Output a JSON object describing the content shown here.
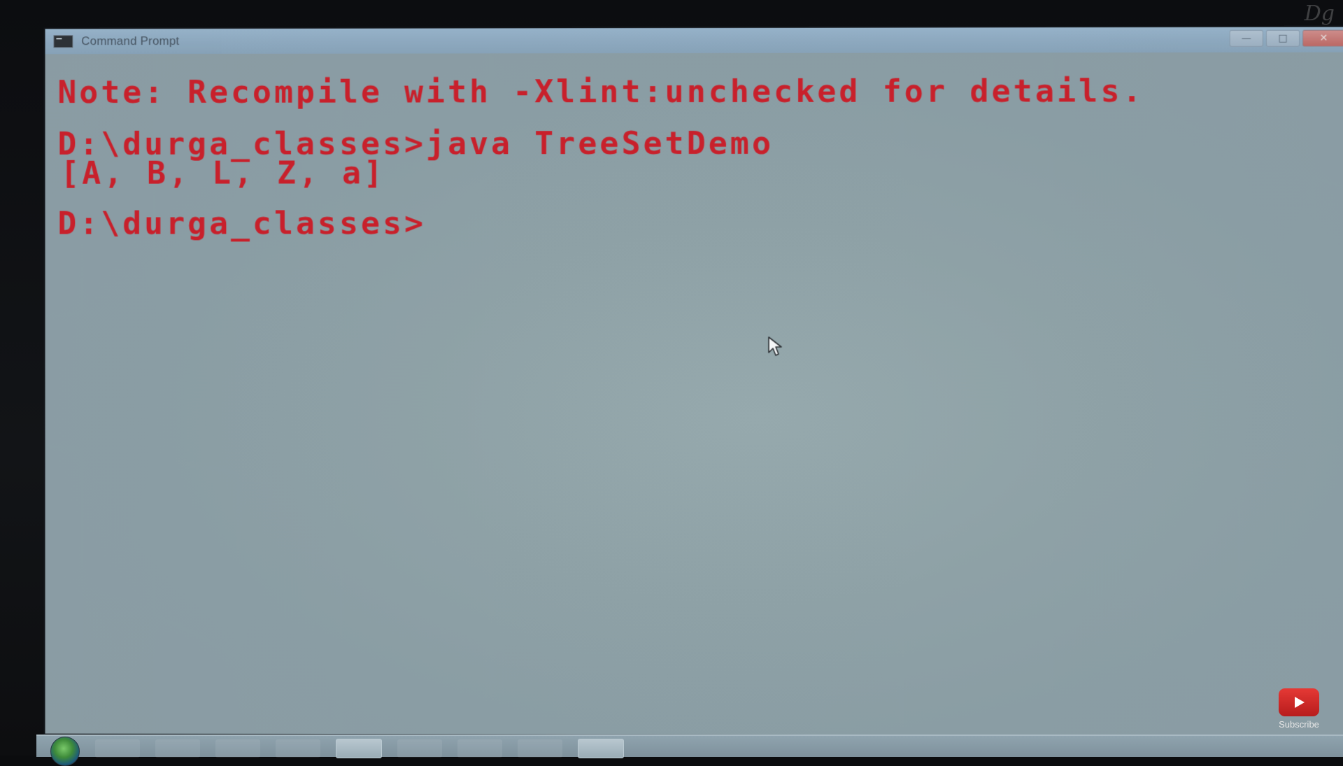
{
  "window": {
    "title": "Command Prompt",
    "controls": {
      "minimize": "—",
      "maximize": "□",
      "close": "✕"
    }
  },
  "console": {
    "text_color": "#c8202b",
    "background_color": "#8ea1a6",
    "lines": [
      "Note: Recompile with -Xlint:unchecked for details.",
      "",
      "D:\\durga_classes>java TreeSetDemo",
      "[A, B, L, Z, a]",
      "",
      "D:\\durga_classes>"
    ]
  },
  "overlay": {
    "subscribe_label": "Subscribe"
  },
  "icons": {
    "window_icon": "console-icon",
    "cursor": "mouse-pointer-icon",
    "youtube": "youtube-play-icon",
    "start": "windows-start-icon"
  }
}
